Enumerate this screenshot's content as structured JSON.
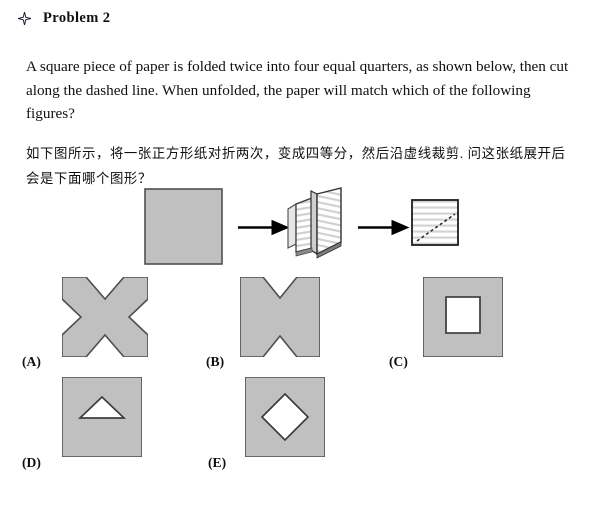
{
  "header": {
    "bullet_icon": "four-pointed-star",
    "title": "Problem 2"
  },
  "question": {
    "english": "A square piece of paper is folded twice into four equal quarters, as shown below, then cut along the dashed line.  When unfolded, the paper will match which of the following figures?",
    "chinese": "如下图所示，将一张正方形纸对折两次，变成四等分，然后沿虚线裁剪. 问这张纸展开后会是下面哪个图形？"
  },
  "diagram": {
    "steps": [
      {
        "id": "step-1",
        "name": "unfolded-square",
        "description": "plain gray square sheet of paper"
      },
      {
        "id": "arrow-1",
        "name": "arrow-right",
        "glyph": "→"
      },
      {
        "id": "step-2",
        "name": "folded-paper-open",
        "description": "paper folded twice shown partly open with hatched panels"
      },
      {
        "id": "arrow-2",
        "name": "arrow-right",
        "glyph": "→"
      },
      {
        "id": "step-3",
        "name": "folded-quarter-with-cut",
        "description": "folded quarter square with dashed diagonal cut line"
      }
    ]
  },
  "colors": {
    "figure_fill": "#c0c0c0",
    "figure_stroke": "#555555",
    "hatch_fill": "#ffffff",
    "hatch_line": "#d0d0d0",
    "ink": "#101010",
    "page_background": "#ffffff"
  },
  "choices": [
    {
      "key": "A",
      "label": "(A)",
      "name": "choice-a",
      "shape": "x-cross",
      "description": "square with triangular notches cut from all four sides forming an X"
    },
    {
      "key": "B",
      "label": "(B)",
      "name": "choice-b",
      "shape": "bowtie",
      "description": "square with triangular notches cut from top and bottom edges"
    },
    {
      "key": "C",
      "label": "(C)",
      "name": "choice-c",
      "shape": "square-hole",
      "description": "square with a square hole in the center"
    },
    {
      "key": "D",
      "label": "(D)",
      "name": "choice-d",
      "shape": "triangle-hole",
      "description": "square with a triangular hole near the upper middle"
    },
    {
      "key": "E",
      "label": "(E)",
      "name": "choice-e",
      "shape": "diamond-hole",
      "description": "square with a diamond shaped hole in the center"
    }
  ]
}
